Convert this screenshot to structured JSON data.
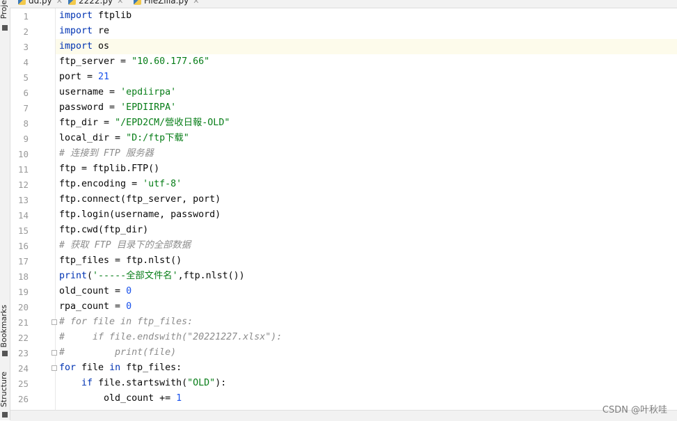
{
  "tabs": [
    {
      "label": "dd.py",
      "active": false
    },
    {
      "label": "2222.py",
      "active": true
    },
    {
      "label": "FileZilla.py",
      "active": false
    }
  ],
  "side_tools": {
    "project": "Proje",
    "bookmarks": "Bookmarks",
    "structure": "Structure"
  },
  "current_line": 3,
  "lines": [
    {
      "n": "1",
      "t": [
        [
          "kw",
          "import"
        ],
        [
          "",
          "ftplib"
        ]
      ]
    },
    {
      "n": "2",
      "t": [
        [
          "kw",
          "import"
        ],
        [
          "",
          "re"
        ]
      ]
    },
    {
      "n": "3",
      "t": [
        [
          "kw",
          "import"
        ],
        [
          "",
          "os"
        ]
      ]
    },
    {
      "n": "4",
      "t": [
        [
          "",
          "ftp_server = "
        ],
        [
          "str",
          "\"10.60.177.66\""
        ]
      ]
    },
    {
      "n": "5",
      "t": [
        [
          "",
          "port = "
        ],
        [
          "num",
          "21"
        ]
      ]
    },
    {
      "n": "6",
      "t": [
        [
          "",
          "username = "
        ],
        [
          "str",
          "'epdiirpa'"
        ]
      ]
    },
    {
      "n": "7",
      "t": [
        [
          "",
          "password = "
        ],
        [
          "str",
          "'EPDIIRPA'"
        ]
      ]
    },
    {
      "n": "8",
      "t": [
        [
          "",
          "ftp_dir = "
        ],
        [
          "str",
          "\"/EPD2CM/營收日報-OLD\""
        ]
      ]
    },
    {
      "n": "9",
      "t": [
        [
          "",
          "local_dir = "
        ],
        [
          "str",
          "\"D:/ftp下载\""
        ]
      ]
    },
    {
      "n": "10",
      "t": [
        [
          "cm",
          "# 连接到 FTP 服务器"
        ]
      ]
    },
    {
      "n": "11",
      "t": [
        [
          "",
          "ftp = ftplib.FTP()"
        ]
      ]
    },
    {
      "n": "12",
      "t": [
        [
          "",
          "ftp.encoding = "
        ],
        [
          "str",
          "'utf-8'"
        ]
      ]
    },
    {
      "n": "13",
      "t": [
        [
          "",
          "ftp.connect(ftp_server, port)"
        ]
      ]
    },
    {
      "n": "14",
      "t": [
        [
          "",
          "ftp.login(username, password)"
        ]
      ]
    },
    {
      "n": "15",
      "t": [
        [
          "",
          "ftp.cwd(ftp_dir)"
        ]
      ]
    },
    {
      "n": "16",
      "t": [
        [
          "cm",
          "# 获取 FTP 目录下的全部数据"
        ]
      ]
    },
    {
      "n": "17",
      "t": [
        [
          "",
          "ftp_files = ftp.nlst()"
        ]
      ]
    },
    {
      "n": "18",
      "t": [
        [
          "kw",
          "print"
        ],
        [
          "",
          "("
        ],
        [
          "str",
          "'-----全部文件名'"
        ],
        [
          "",
          ",ftp.nlst())"
        ]
      ]
    },
    {
      "n": "19",
      "t": [
        [
          "",
          "old_count = "
        ],
        [
          "num",
          "0"
        ]
      ]
    },
    {
      "n": "20",
      "t": [
        [
          "",
          "rpa_count = "
        ],
        [
          "num",
          "0"
        ]
      ]
    },
    {
      "n": "21",
      "t": [
        [
          "cm",
          "# for file in ftp_files:"
        ]
      ]
    },
    {
      "n": "22",
      "t": [
        [
          "cm",
          "#     if file.endswith(\"20221227.xlsx\"):"
        ]
      ]
    },
    {
      "n": "23",
      "t": [
        [
          "cm",
          "#         print(file)"
        ]
      ]
    },
    {
      "n": "24",
      "t": [
        [
          "kw",
          "for"
        ],
        [
          "",
          "file "
        ],
        [
          "kw",
          "in"
        ],
        [
          "",
          "ftp_files:"
        ]
      ]
    },
    {
      "n": "25",
      "t": [
        [
          "",
          "    "
        ],
        [
          "kw",
          "if"
        ],
        [
          "",
          "file.startswith("
        ],
        [
          "str",
          "\"OLD\""
        ],
        [
          "",
          "):"
        ]
      ]
    },
    {
      "n": "26",
      "t": [
        [
          "",
          "        old_count += "
        ],
        [
          "num",
          "1"
        ]
      ]
    }
  ],
  "watermark": "CSDN @叶秋哇",
  "colors": {
    "keyword": "#0033b3",
    "string": "#067d17",
    "number": "#1750eb",
    "comment": "#8c8c8c",
    "current_line": "#fdfbeb"
  }
}
